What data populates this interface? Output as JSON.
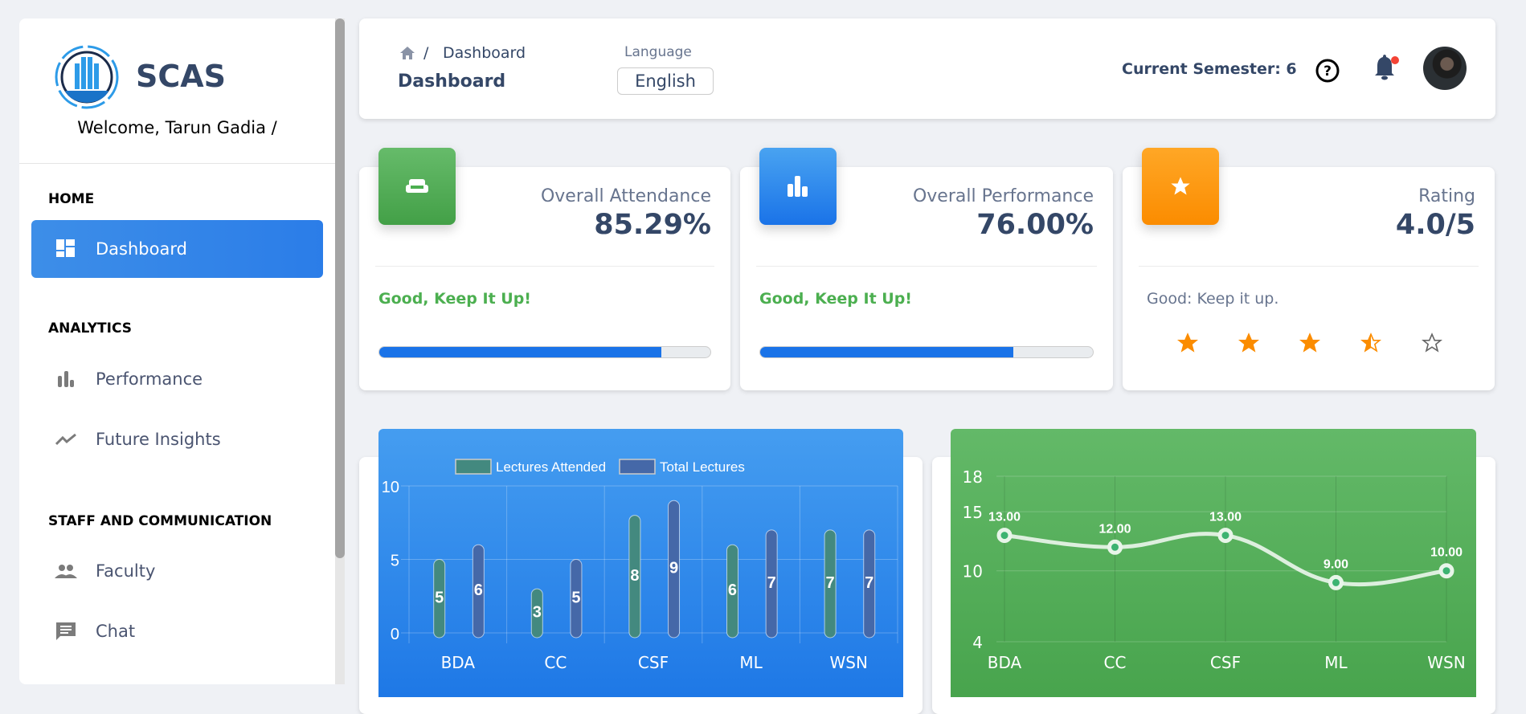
{
  "sidebar": {
    "brand": "SCAS",
    "welcome": "Welcome, Tarun Gadia /",
    "sections": [
      {
        "title": "HOME"
      },
      {
        "title": "ANALYTICS"
      },
      {
        "title": "STAFF AND COMMUNICATION"
      }
    ],
    "items": [
      {
        "label": "Dashboard",
        "icon": "dashboard-icon"
      },
      {
        "label": "Performance",
        "icon": "bar-chart-icon"
      },
      {
        "label": "Future Insights",
        "icon": "trend-icon"
      },
      {
        "label": "Faculty",
        "icon": "people-icon"
      },
      {
        "label": "Chat",
        "icon": "chat-icon"
      }
    ]
  },
  "header": {
    "breadcrumb": "Dashboard",
    "title": "Dashboard",
    "language_label": "Language",
    "language": "English",
    "semester": "Current Semester: 6"
  },
  "stats": [
    {
      "title": "Overall Attendance",
      "value": "85.29%",
      "note": "Good, Keep It Up!",
      "progress": 85.29,
      "color": "#4caf50"
    },
    {
      "title": "Overall Performance",
      "value": "76.00%",
      "note": "Good, Keep It Up!",
      "progress": 76,
      "color": "#1a73e8"
    },
    {
      "title": "Rating",
      "value": "4.0/5",
      "note": "Good: Keep it up.",
      "stars": [
        1,
        1,
        1,
        0.5,
        0
      ],
      "color": "#fb8c00"
    }
  ],
  "chart_data": [
    {
      "type": "bar",
      "categories": [
        "BDA",
        "CC",
        "CSF",
        "ML",
        "WSN"
      ],
      "series": [
        {
          "name": "Lectures Attended",
          "values": [
            5,
            3,
            8,
            6,
            7
          ],
          "color": "#43897f"
        },
        {
          "name": "Total Lectures",
          "values": [
            6,
            5,
            9,
            7,
            7
          ],
          "color": "#4568a8"
        }
      ],
      "ylim": [
        0,
        10
      ],
      "yticks": [
        "0",
        "5",
        "10"
      ],
      "legend": "top"
    },
    {
      "type": "line",
      "categories": [
        "BDA",
        "CC",
        "CSF",
        "ML",
        "WSN"
      ],
      "values": [
        13,
        12,
        13,
        9,
        10
      ],
      "labels": [
        "13.00",
        "12.00",
        "13.00",
        "9.00",
        "10.00"
      ],
      "ylim": [
        4,
        18
      ],
      "yticks": [
        4,
        10,
        15,
        18
      ]
    }
  ]
}
